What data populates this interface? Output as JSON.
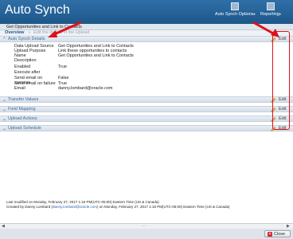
{
  "header": {
    "title": "Auto Synch",
    "buttons": [
      {
        "label": "Auto Synch Options",
        "icon": "options-icon"
      },
      {
        "label": "Reporting",
        "icon": "reporting-icon"
      }
    ]
  },
  "subtitle": "Get Opportunities and Link to Contacts",
  "breadcrumb": {
    "overview": "Overview",
    "sep": "›",
    "current": "Edit the details of the Upload"
  },
  "sections": [
    {
      "label": "Auto Synch Details",
      "edit": "Edit",
      "expanded": true
    },
    {
      "label": "Transfer Values",
      "edit": "Edit",
      "expanded": false
    },
    {
      "label": "Field Mapping",
      "edit": "Edit",
      "expanded": false
    },
    {
      "label": "Upload Actions",
      "edit": "Edit",
      "expanded": false
    },
    {
      "label": "Upload Schedule",
      "edit": "Edit",
      "expanded": false
    }
  ],
  "details": [
    {
      "k": "Data Upload Source",
      "v": "Get Opportunities and Link to Contacts"
    },
    {
      "k": "Upload Purpose",
      "v": "Link these opportunities to contacts"
    },
    {
      "k": "Name",
      "v": "Get Opportunities and Link to Contacts"
    },
    {
      "k": "Description",
      "v": ""
    },
    {
      "k": "Enabled",
      "v": "True"
    },
    {
      "k": "Execute after",
      "v": ""
    },
    {
      "k": "Send email on success",
      "v": "False"
    },
    {
      "k": "Send email on failure",
      "v": "True"
    },
    {
      "k": "Email",
      "v": "danny.lombard@oracle.com"
    }
  ],
  "footer": {
    "modified": "Last modified on Monday, February 27, 2017 1:16 PM(UTC-05:00) Eastern Time (US & Canada)",
    "created_prefix": "Created by Danny Lombard (",
    "created_email": "danny.lombard@oracle.com",
    "created_suffix": ") on Monday, February 27, 2017 1:16 PM(UTC-05:00) Eastern Time (US & Canada)"
  },
  "bottom": {
    "close": "Close"
  },
  "colors": {
    "header": "#1d5789",
    "accent": "#3b6a99",
    "annotation": "#e0101a"
  }
}
